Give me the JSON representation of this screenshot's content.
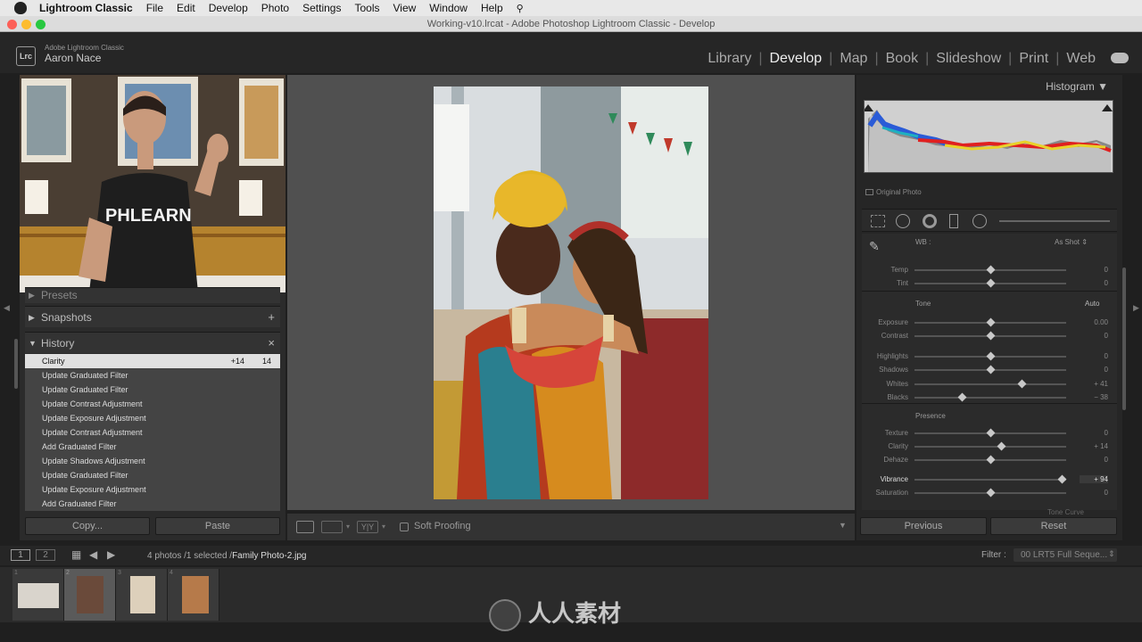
{
  "menubar": {
    "items": [
      "Lightroom Classic",
      "File",
      "Edit",
      "Develop",
      "Photo",
      "Settings",
      "Tools",
      "View",
      "Window",
      "Help"
    ]
  },
  "window": {
    "title": "Working-v10.lrcat - Adobe Photoshop Lightroom Classic - Develop"
  },
  "identity": {
    "badge": "Lrc",
    "product": "Adobe Lightroom Classic",
    "user": "Aaron Nace"
  },
  "modules": [
    "Library",
    "Develop",
    "Map",
    "Book",
    "Slideshow",
    "Print",
    "Web"
  ],
  "modules_active": "Develop",
  "left": {
    "presets_label": "Presets",
    "snapshots_label": "Snapshots",
    "history_label": "History",
    "history": [
      {
        "name": "Clarity",
        "before": "+14",
        "after": "14"
      },
      {
        "name": "Update Graduated Filter"
      },
      {
        "name": "Update Graduated Filter"
      },
      {
        "name": "Update Contrast Adjustment"
      },
      {
        "name": "Update Exposure Adjustment"
      },
      {
        "name": "Update Contrast Adjustment"
      },
      {
        "name": "Add Graduated Filter"
      },
      {
        "name": "Update Shadows Adjustment"
      },
      {
        "name": "Update Graduated Filter"
      },
      {
        "name": "Update Exposure Adjustment"
      },
      {
        "name": "Add Graduated Filter"
      }
    ],
    "copy_label": "Copy...",
    "paste_label": "Paste",
    "webcam_shirt": "PHLEARN"
  },
  "toolbar": {
    "soft_proofing": "Soft Proofing"
  },
  "right": {
    "histogram_label": "Histogram",
    "original_photo": "Original Photo",
    "wb_label": "WB :",
    "wb_value": "As Shot",
    "tone_label": "Tone",
    "auto_label": "Auto",
    "presence_label": "Presence",
    "tone_curve_label": "Tone Curve",
    "sliders": [
      {
        "label": "Temp",
        "value": "0",
        "pos": 0.5
      },
      {
        "label": "Tint",
        "value": "0",
        "pos": 0.5
      },
      {
        "label": "Exposure",
        "value": "0.00",
        "pos": 0.5
      },
      {
        "label": "Contrast",
        "value": "0",
        "pos": 0.5
      },
      {
        "label": "Highlights",
        "value": "0",
        "pos": 0.5
      },
      {
        "label": "Shadows",
        "value": "0",
        "pos": 0.5
      },
      {
        "label": "Whites",
        "value": "+ 41",
        "pos": 0.705
      },
      {
        "label": "Blacks",
        "value": "− 38",
        "pos": 0.31
      },
      {
        "label": "Texture",
        "value": "0",
        "pos": 0.5
      },
      {
        "label": "Clarity",
        "value": "+ 14",
        "pos": 0.57
      },
      {
        "label": "Dehaze",
        "value": "0",
        "pos": 0.5
      },
      {
        "label": "Vibrance",
        "value": "+ 94",
        "pos": 0.97
      },
      {
        "label": "Saturation",
        "value": "0",
        "pos": 0.5
      }
    ],
    "previous_label": "Previous",
    "reset_label": "Reset"
  },
  "filmbar": {
    "page1": "1",
    "page2": "2",
    "info": "4 photos /1 selected /",
    "filename": "Family Photo-2.jpg",
    "filter_label": "Filter :",
    "filter_value": "00 LRT5 Full Seque..."
  },
  "filmstrip": {
    "thumb_numbers": [
      "1",
      "2",
      "3",
      "4"
    ]
  },
  "watermark": {
    "text": "人人素材"
  },
  "colors": {
    "accent": "#e0e0e0",
    "panel": "#2b2b2b",
    "background": "#505050"
  }
}
